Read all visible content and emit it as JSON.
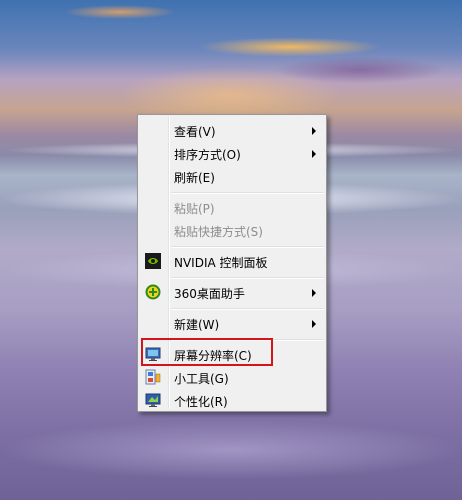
{
  "context_menu": {
    "items": [
      {
        "label": "查看(V)",
        "has_submenu": true,
        "enabled": true
      },
      {
        "label": "排序方式(O)",
        "has_submenu": true,
        "enabled": true
      },
      {
        "label": "刷新(E)",
        "has_submenu": false,
        "enabled": true
      },
      {
        "label": "粘贴(P)",
        "has_submenu": false,
        "enabled": false
      },
      {
        "label": "粘贴快捷方式(S)",
        "has_submenu": false,
        "enabled": false
      },
      {
        "label": "NVIDIA 控制面板",
        "has_submenu": false,
        "enabled": true,
        "icon": "nvidia-icon"
      },
      {
        "label": "360桌面助手",
        "has_submenu": true,
        "enabled": true,
        "icon": "360-assistant-icon"
      },
      {
        "label": "新建(W)",
        "has_submenu": true,
        "enabled": true
      },
      {
        "label": "屏幕分辨率(C)",
        "has_submenu": false,
        "enabled": true,
        "icon": "screen-resolution-icon",
        "highlighted": true
      },
      {
        "label": "小工具(G)",
        "has_submenu": false,
        "enabled": true,
        "icon": "gadgets-icon"
      },
      {
        "label": "个性化(R)",
        "has_submenu": false,
        "enabled": true,
        "icon": "personalize-icon"
      }
    ]
  },
  "colors": {
    "menu_background": "#f0f0f0",
    "menu_border": "#979797",
    "disabled_text": "#8d8d8d",
    "annotation_box": "#d3141b"
  }
}
